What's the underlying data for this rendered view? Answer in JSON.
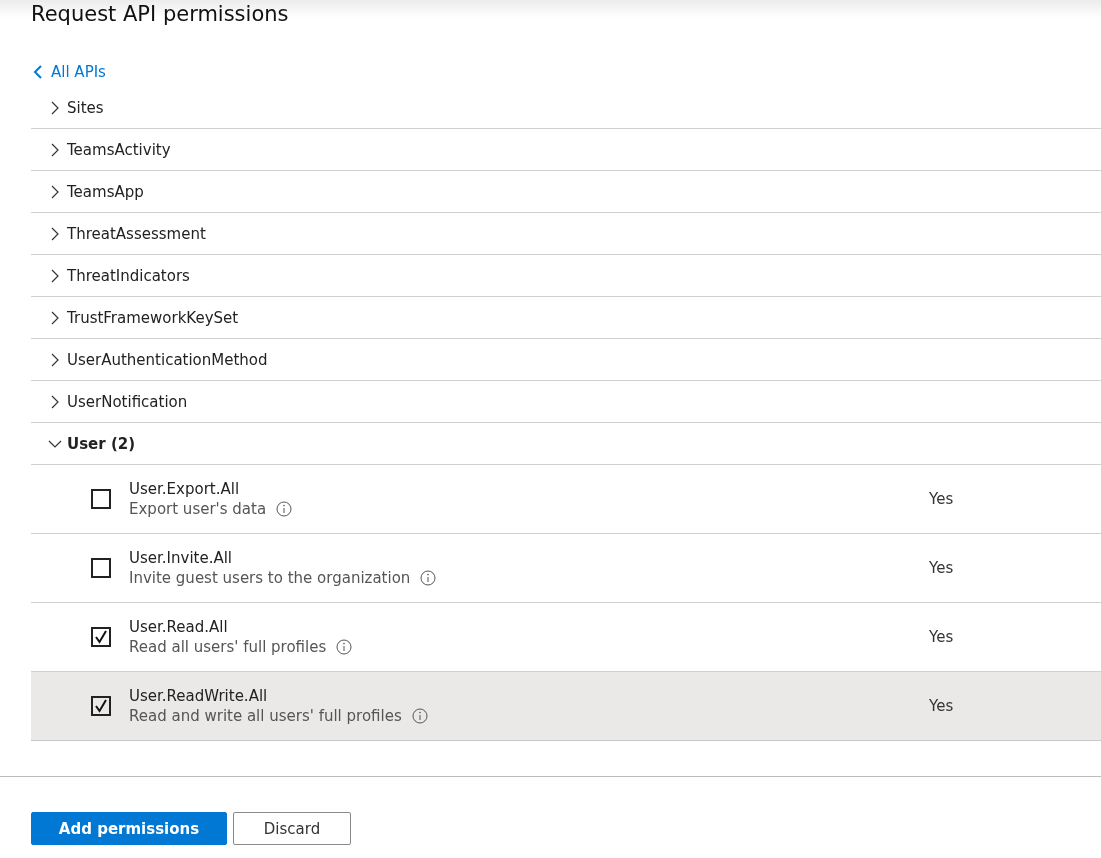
{
  "title": "Request API permissions",
  "back_link": "All APIs",
  "groups": [
    {
      "name": "Sites",
      "expanded": false
    },
    {
      "name": "TeamsActivity",
      "expanded": false
    },
    {
      "name": "TeamsApp",
      "expanded": false
    },
    {
      "name": "ThreatAssessment",
      "expanded": false
    },
    {
      "name": "ThreatIndicators",
      "expanded": false
    },
    {
      "name": "TrustFrameworkKeySet",
      "expanded": false
    },
    {
      "name": "UserAuthenticationMethod",
      "expanded": false
    },
    {
      "name": "UserNotification",
      "expanded": false
    },
    {
      "name": "User (2)",
      "expanded": true,
      "permissions": [
        {
          "name": "User.Export.All",
          "description": "Export user's data",
          "admin_consent": "Yes",
          "checked": false,
          "highlighted": false
        },
        {
          "name": "User.Invite.All",
          "description": "Invite guest users to the organization",
          "admin_consent": "Yes",
          "checked": false,
          "highlighted": false
        },
        {
          "name": "User.Read.All",
          "description": "Read all users' full profiles",
          "admin_consent": "Yes",
          "checked": true,
          "highlighted": false
        },
        {
          "name": "User.ReadWrite.All",
          "description": "Read and write all users' full profiles",
          "admin_consent": "Yes",
          "checked": true,
          "highlighted": true
        }
      ]
    }
  ],
  "buttons": [
    {
      "label": "Add permissions",
      "kind": "primary"
    },
    {
      "label": "Discard",
      "kind": "secondary"
    }
  ]
}
